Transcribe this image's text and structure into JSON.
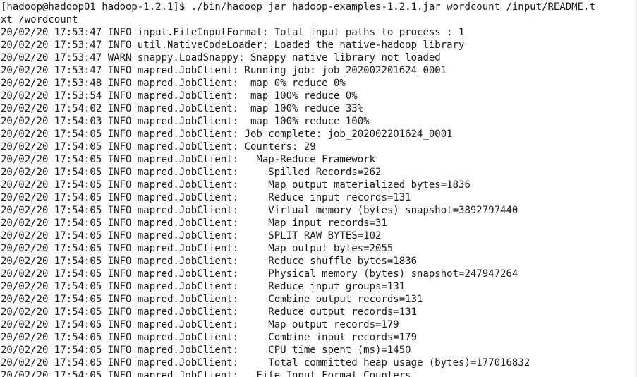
{
  "terminal": {
    "lines": [
      "[hadoop@hadoop01 hadoop-1.2.1]$ ./bin/hadoop jar hadoop-examples-1.2.1.jar wordcount /input/README.t",
      "xt /wordcount",
      "20/02/20 17:53:47 INFO input.FileInputFormat: Total input paths to process : 1",
      "20/02/20 17:53:47 INFO util.NativeCodeLoader: Loaded the native-hadoop library",
      "20/02/20 17:53:47 WARN snappy.LoadSnappy: Snappy native library not loaded",
      "20/02/20 17:53:47 INFO mapred.JobClient: Running job: job_202002201624_0001",
      "20/02/20 17:53:48 INFO mapred.JobClient:  map 0% reduce 0%",
      "20/02/20 17:53:54 INFO mapred.JobClient:  map 100% reduce 0%",
      "20/02/20 17:54:02 INFO mapred.JobClient:  map 100% reduce 33%",
      "20/02/20 17:54:03 INFO mapred.JobClient:  map 100% reduce 100%",
      "20/02/20 17:54:05 INFO mapred.JobClient: Job complete: job_202002201624_0001",
      "20/02/20 17:54:05 INFO mapred.JobClient: Counters: 29",
      "20/02/20 17:54:05 INFO mapred.JobClient:   Map-Reduce Framework",
      "20/02/20 17:54:05 INFO mapred.JobClient:     Spilled Records=262",
      "20/02/20 17:54:05 INFO mapred.JobClient:     Map output materialized bytes=1836",
      "20/02/20 17:54:05 INFO mapred.JobClient:     Reduce input records=131",
      "20/02/20 17:54:05 INFO mapred.JobClient:     Virtual memory (bytes) snapshot=3892797440",
      "20/02/20 17:54:05 INFO mapred.JobClient:     Map input records=31",
      "20/02/20 17:54:05 INFO mapred.JobClient:     SPLIT_RAW_BYTES=102",
      "20/02/20 17:54:05 INFO mapred.JobClient:     Map output bytes=2055",
      "20/02/20 17:54:05 INFO mapred.JobClient:     Reduce shuffle bytes=1836",
      "20/02/20 17:54:05 INFO mapred.JobClient:     Physical memory (bytes) snapshot=247947264",
      "20/02/20 17:54:05 INFO mapred.JobClient:     Reduce input groups=131",
      "20/02/20 17:54:05 INFO mapred.JobClient:     Combine output records=131",
      "20/02/20 17:54:05 INFO mapred.JobClient:     Reduce output records=131",
      "20/02/20 17:54:05 INFO mapred.JobClient:     Map output records=179",
      "20/02/20 17:54:05 INFO mapred.JobClient:     Combine input records=179",
      "20/02/20 17:54:05 INFO mapred.JobClient:     CPU time spent (ms)=1450",
      "20/02/20 17:54:05 INFO mapred.JobClient:     Total committed heap usage (bytes)=177016832",
      "20/02/20 17:54:05 INFO mapred.JobClient:   File Input Format Counters"
    ]
  }
}
